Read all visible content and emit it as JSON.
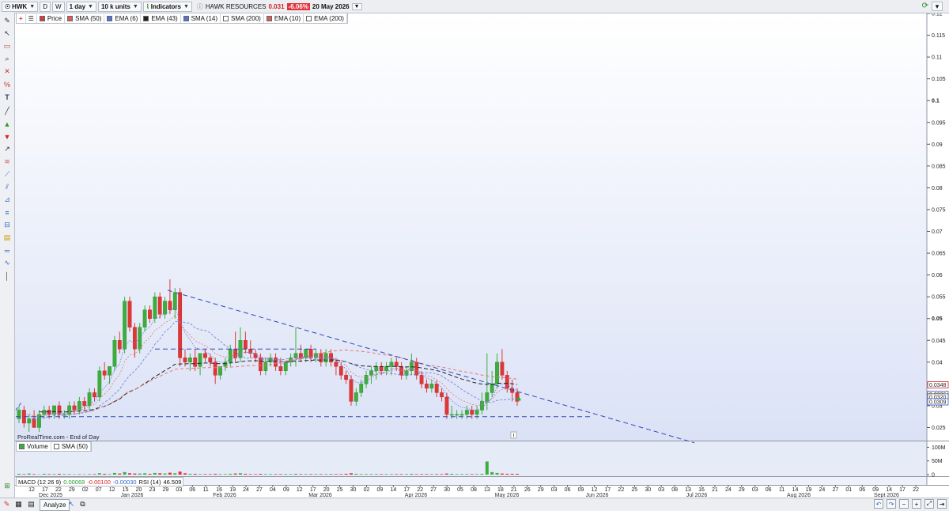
{
  "toolbar": {
    "symbol": "HWK",
    "mode_d": "D",
    "mode_w": "W",
    "timeframe": "1 day",
    "units": "10 k units",
    "indicators_label": "Indicators"
  },
  "title": {
    "name": "HAWK RESOURCES",
    "price": "0.031",
    "change": "-6.06%",
    "date": "20 May 2026"
  },
  "legend": [
    {
      "label": "Price",
      "color": "#d93a3a"
    },
    {
      "label": "SMA (50)",
      "color": "#e05a5a"
    },
    {
      "label": "EMA (6)",
      "color": "#5b6fd6"
    },
    {
      "label": "EMA (43)",
      "color": "#222222"
    },
    {
      "label": "SMA (14)",
      "color": "#5b6fd6"
    },
    {
      "label": "SMA (200)",
      "color": "#ffffff"
    },
    {
      "label": "EMA (10)",
      "color": "#e05a5a"
    },
    {
      "label": "EMA (200)",
      "color": "#ffffff"
    }
  ],
  "price_axis": {
    "ticks": [
      "0.12",
      "0.115",
      "0.11",
      "0.105",
      "0.1",
      "0.095",
      "0.09",
      "0.085",
      "0.08",
      "0.075",
      "0.07",
      "0.065",
      "0.06",
      "0.055",
      "0.05",
      "0.045",
      "0.04",
      "0.035",
      "0.03",
      "0.025"
    ],
    "tags": [
      {
        "value": "0.0348",
        "bg": "#ffffff",
        "fg": "#d21f1f",
        "border": "#d21f1f"
      },
      {
        "value": "0.0326",
        "bg": "#ffffff",
        "fg": "#3a52c8",
        "border": "#3a52c8"
      },
      {
        "value": "0.0320",
        "bg": "#ffffff",
        "fg": "#333333",
        "border": "#555555"
      },
      {
        "value": "0.0309",
        "bg": "#ffffff",
        "fg": "#3a52c8",
        "border": "#3a52c8"
      }
    ]
  },
  "source": "ProRealTime.com - End of Day",
  "volume": {
    "legend": [
      {
        "label": "Volume",
        "color": "#3cae3c"
      },
      {
        "label": "SMA (50)",
        "color": "#ffffff"
      }
    ],
    "ticks": [
      "100M",
      "50M",
      "0"
    ]
  },
  "indicators": {
    "macd_label": "MACD (12 26 9)",
    "macd_v1": "0.00069",
    "macd_v2": "-0.00100",
    "macd_v3": "-0.00030",
    "rsi_label": "RSI (14)",
    "rsi_value": "46.509"
  },
  "time_axis": {
    "days": [
      "12",
      "17",
      "22",
      "29",
      "02",
      "07",
      "12",
      "15",
      "20",
      "23",
      "29",
      "03",
      "06",
      "11",
      "16",
      "19",
      "24",
      "27",
      "04",
      "09",
      "12",
      "17",
      "20",
      "25",
      "30",
      "02",
      "09",
      "14",
      "17",
      "22",
      "27",
      "30",
      "05",
      "08",
      "13",
      "18",
      "21",
      "26",
      "29",
      "03",
      "06",
      "09",
      "12",
      "17",
      "22",
      "25",
      "30",
      "03",
      "08",
      "13",
      "16",
      "21",
      "24",
      "29",
      "03",
      "06",
      "11",
      "14",
      "19",
      "24",
      "27",
      "01",
      "06",
      "09",
      "14",
      "17",
      "22"
    ],
    "months": [
      "Dec 2025",
      "Jan 2026",
      "Feb 2026",
      "Mar 2026",
      "Apr 2026",
      "May 2026",
      "Jun 2026",
      "Jul 2026",
      "Aug 2026",
      "Sept 2026"
    ]
  },
  "bottom": {
    "analyze_label": "Analyze"
  },
  "chart_data": {
    "type": "candlestick",
    "ylim": [
      0.022,
      0.12
    ],
    "candles": [
      [
        0.027,
        0.03,
        0.026,
        0.029
      ],
      [
        0.029,
        0.03,
        0.025,
        0.026
      ],
      [
        0.026,
        0.028,
        0.024,
        0.027
      ],
      [
        0.027,
        0.029,
        0.025,
        0.025
      ],
      [
        0.025,
        0.029,
        0.024,
        0.028
      ],
      [
        0.028,
        0.03,
        0.027,
        0.029
      ],
      [
        0.029,
        0.03,
        0.027,
        0.028
      ],
      [
        0.028,
        0.03,
        0.027,
        0.03
      ],
      [
        0.03,
        0.031,
        0.027,
        0.028
      ],
      [
        0.028,
        0.029,
        0.027,
        0.028
      ],
      [
        0.028,
        0.031,
        0.027,
        0.03
      ],
      [
        0.03,
        0.031,
        0.028,
        0.029
      ],
      [
        0.029,
        0.032,
        0.028,
        0.031
      ],
      [
        0.031,
        0.032,
        0.029,
        0.03
      ],
      [
        0.03,
        0.034,
        0.029,
        0.033
      ],
      [
        0.033,
        0.034,
        0.031,
        0.032
      ],
      [
        0.032,
        0.039,
        0.031,
        0.038
      ],
      [
        0.038,
        0.04,
        0.036,
        0.037
      ],
      [
        0.037,
        0.039,
        0.035,
        0.039
      ],
      [
        0.039,
        0.046,
        0.038,
        0.045
      ],
      [
        0.045,
        0.047,
        0.042,
        0.043
      ],
      [
        0.043,
        0.055,
        0.042,
        0.054
      ],
      [
        0.054,
        0.055,
        0.047,
        0.048
      ],
      [
        0.048,
        0.049,
        0.041,
        0.043
      ],
      [
        0.043,
        0.049,
        0.042,
        0.048
      ],
      [
        0.048,
        0.053,
        0.047,
        0.052
      ],
      [
        0.052,
        0.053,
        0.049,
        0.05
      ],
      [
        0.05,
        0.056,
        0.049,
        0.055
      ],
      [
        0.055,
        0.056,
        0.05,
        0.051
      ],
      [
        0.051,
        0.055,
        0.05,
        0.054
      ],
      [
        0.054,
        0.059,
        0.051,
        0.052
      ],
      [
        0.052,
        0.057,
        0.05,
        0.056
      ],
      [
        0.056,
        0.057,
        0.039,
        0.041
      ],
      [
        0.041,
        0.043,
        0.039,
        0.04
      ],
      [
        0.04,
        0.042,
        0.038,
        0.041
      ],
      [
        0.041,
        0.043,
        0.038,
        0.039
      ],
      [
        0.039,
        0.042,
        0.037,
        0.042
      ],
      [
        0.042,
        0.043,
        0.04,
        0.041
      ],
      [
        0.041,
        0.042,
        0.039,
        0.04
      ],
      [
        0.04,
        0.041,
        0.035,
        0.037
      ],
      [
        0.037,
        0.039,
        0.036,
        0.039
      ],
      [
        0.039,
        0.041,
        0.038,
        0.04
      ],
      [
        0.04,
        0.044,
        0.039,
        0.043
      ],
      [
        0.043,
        0.047,
        0.04,
        0.041
      ],
      [
        0.041,
        0.048,
        0.04,
        0.045
      ],
      [
        0.045,
        0.047,
        0.042,
        0.043
      ],
      [
        0.043,
        0.045,
        0.041,
        0.042
      ],
      [
        0.042,
        0.043,
        0.04,
        0.041
      ],
      [
        0.041,
        0.042,
        0.037,
        0.038
      ],
      [
        0.038,
        0.041,
        0.037,
        0.04
      ],
      [
        0.04,
        0.042,
        0.039,
        0.041
      ],
      [
        0.041,
        0.042,
        0.038,
        0.039
      ],
      [
        0.039,
        0.041,
        0.037,
        0.038
      ],
      [
        0.038,
        0.04,
        0.037,
        0.04
      ],
      [
        0.04,
        0.042,
        0.039,
        0.041
      ],
      [
        0.041,
        0.048,
        0.039,
        0.042
      ],
      [
        0.042,
        0.044,
        0.04,
        0.041
      ],
      [
        0.041,
        0.043,
        0.04,
        0.043
      ],
      [
        0.043,
        0.044,
        0.04,
        0.041
      ],
      [
        0.041,
        0.043,
        0.04,
        0.042
      ],
      [
        0.042,
        0.043,
        0.039,
        0.04
      ],
      [
        0.04,
        0.043,
        0.039,
        0.042
      ],
      [
        0.042,
        0.043,
        0.039,
        0.04
      ],
      [
        0.04,
        0.041,
        0.037,
        0.039
      ],
      [
        0.039,
        0.04,
        0.036,
        0.037
      ],
      [
        0.037,
        0.038,
        0.035,
        0.036
      ],
      [
        0.036,
        0.037,
        0.03,
        0.031
      ],
      [
        0.031,
        0.034,
        0.03,
        0.033
      ],
      [
        0.033,
        0.036,
        0.032,
        0.035
      ],
      [
        0.035,
        0.038,
        0.034,
        0.037
      ],
      [
        0.037,
        0.039,
        0.035,
        0.038
      ],
      [
        0.038,
        0.04,
        0.036,
        0.039
      ],
      [
        0.039,
        0.04,
        0.037,
        0.038
      ],
      [
        0.038,
        0.04,
        0.037,
        0.039
      ],
      [
        0.039,
        0.041,
        0.037,
        0.04
      ],
      [
        0.04,
        0.041,
        0.038,
        0.039
      ],
      [
        0.039,
        0.04,
        0.036,
        0.037
      ],
      [
        0.037,
        0.039,
        0.036,
        0.038
      ],
      [
        0.038,
        0.042,
        0.037,
        0.04
      ],
      [
        0.04,
        0.041,
        0.036,
        0.037
      ],
      [
        0.037,
        0.038,
        0.034,
        0.035
      ],
      [
        0.035,
        0.036,
        0.033,
        0.034
      ],
      [
        0.034,
        0.036,
        0.033,
        0.035
      ],
      [
        0.035,
        0.036,
        0.032,
        0.033
      ],
      [
        0.033,
        0.034,
        0.031,
        0.032
      ],
      [
        0.032,
        0.033,
        0.027,
        0.028
      ],
      [
        0.028,
        0.03,
        0.027,
        0.028
      ],
      [
        0.028,
        0.029,
        0.027,
        0.028
      ],
      [
        0.028,
        0.029,
        0.027,
        0.028
      ],
      [
        0.028,
        0.03,
        0.027,
        0.029
      ],
      [
        0.029,
        0.03,
        0.027,
        0.028
      ],
      [
        0.028,
        0.03,
        0.027,
        0.029
      ],
      [
        0.029,
        0.033,
        0.028,
        0.031
      ],
      [
        0.031,
        0.042,
        0.029,
        0.033
      ],
      [
        0.033,
        0.038,
        0.032,
        0.035
      ],
      [
        0.035,
        0.042,
        0.034,
        0.04
      ],
      [
        0.04,
        0.043,
        0.036,
        0.037
      ],
      [
        0.037,
        0.038,
        0.033,
        0.034
      ],
      [
        0.034,
        0.036,
        0.031,
        0.033
      ],
      [
        0.033,
        0.034,
        0.03,
        0.031
      ]
    ],
    "volumes": [
      3,
      2,
      4,
      2,
      1,
      3,
      2,
      2,
      3,
      2,
      2,
      1,
      2,
      1,
      2,
      2,
      5,
      3,
      2,
      6,
      4,
      9,
      5,
      4,
      4,
      5,
      3,
      6,
      5,
      4,
      7,
      5,
      11,
      5,
      3,
      3,
      2,
      2,
      2,
      3,
      2,
      2,
      3,
      4,
      5,
      3,
      2,
      2,
      3,
      2,
      2,
      2,
      2,
      2,
      2,
      3,
      2,
      2,
      2,
      2,
      2,
      2,
      2,
      2,
      2,
      3,
      5,
      3,
      2,
      2,
      2,
      2,
      2,
      2,
      2,
      2,
      2,
      2,
      3,
      2,
      2,
      2,
      2,
      2,
      2,
      4,
      3,
      2,
      2,
      2,
      2,
      2,
      3,
      48,
      9,
      6,
      4,
      3,
      3,
      3
    ]
  }
}
